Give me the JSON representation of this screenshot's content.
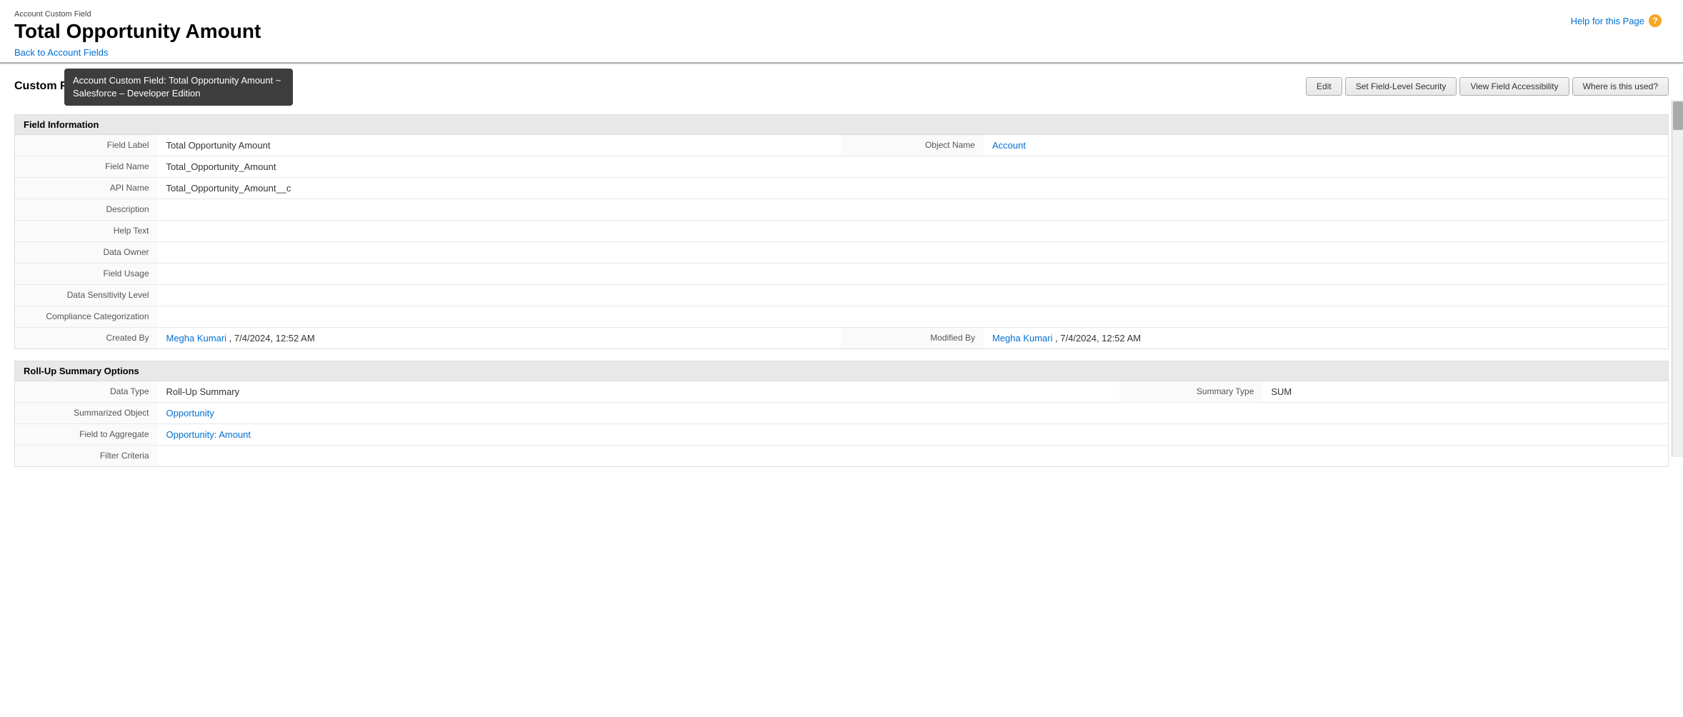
{
  "header": {
    "object_type": "Account Custom Field",
    "title": "Total Opportunity Amount",
    "back_link_text": "Back to Account Fields",
    "back_link_href": "#"
  },
  "help": {
    "label": "Help for this Page"
  },
  "tooltip": {
    "text": "Account Custom Field: Total Opportunity Amount ~ Salesforce – Developer Edition"
  },
  "toolbar": {
    "title": "Custom Field Definition Detail",
    "buttons": {
      "edit": "Edit",
      "set_security": "Set Field-Level Security",
      "view_accessibility": "View Field Accessibility",
      "where_used": "Where is this used?"
    }
  },
  "field_information": {
    "section_title": "Field Information",
    "fields": [
      {
        "label": "Field Label",
        "value": "Total Opportunity Amount"
      },
      {
        "label": "Field Name",
        "value": "Total_Opportunity_Amount"
      },
      {
        "label": "API Name",
        "value": "Total_Opportunity_Amount__c"
      },
      {
        "label": "Description",
        "value": ""
      },
      {
        "label": "Help Text",
        "value": ""
      },
      {
        "label": "Data Owner",
        "value": ""
      },
      {
        "label": "Field Usage",
        "value": ""
      },
      {
        "label": "Data Sensitivity Level",
        "value": ""
      },
      {
        "label": "Compliance Categorization",
        "value": ""
      },
      {
        "label": "Created By",
        "value": "Megha Kumari",
        "extra": ", 7/4/2024, 12:52 AM",
        "link": true
      },
      {
        "label": "Object Name",
        "value": "Account",
        "link": true,
        "right": true
      },
      {
        "label": "Modified By",
        "value": "Megha Kumari",
        "extra": ", 7/4/2024, 12:52 AM",
        "link": true,
        "right_label": "Modified By"
      }
    ]
  },
  "rollup_summary": {
    "section_title": "Roll-Up Summary Options",
    "fields": [
      {
        "label": "Data Type",
        "value": "Roll-Up Summary"
      },
      {
        "label": "Summary Type",
        "value": "SUM",
        "right": true
      },
      {
        "label": "Summarized Object",
        "value": "Opportunity",
        "link": true
      },
      {
        "label": "Field to Aggregate",
        "value": "Opportunity: Amount",
        "link": true
      },
      {
        "label": "Filter Criteria",
        "value": ""
      }
    ]
  }
}
